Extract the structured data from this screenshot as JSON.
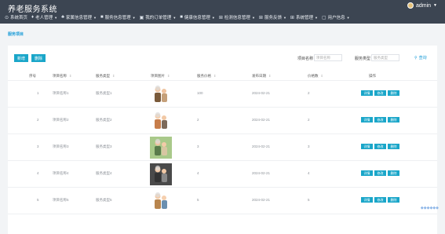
{
  "app": {
    "title": "养老服务系统",
    "user": "admin"
  },
  "nav": [
    {
      "icon": "home-icon",
      "glyph": "⊙",
      "label": "系统首页",
      "caret": false
    },
    {
      "icon": "user-icon",
      "glyph": "♦",
      "label": "老人管理",
      "caret": true
    },
    {
      "icon": "family-icon",
      "glyph": "♣",
      "label": "家属信息管理",
      "caret": true
    },
    {
      "icon": "service-icon",
      "glyph": "■",
      "label": "服务信息管理",
      "caret": true
    },
    {
      "icon": "order-icon",
      "glyph": "▣",
      "label": "我的订单管理",
      "caret": true
    },
    {
      "icon": "health-icon",
      "glyph": "■",
      "label": "健康信息管理",
      "caret": true
    },
    {
      "icon": "grid-icon",
      "glyph": "⊞",
      "label": "检测信息管理",
      "caret": true
    },
    {
      "icon": "grid-icon",
      "glyph": "⊞",
      "label": "服务反馈",
      "caret": true
    },
    {
      "icon": "grid-icon",
      "glyph": "⊞",
      "label": "系统管理",
      "caret": true
    },
    {
      "icon": "window-icon",
      "glyph": "▢",
      "label": "用户信息",
      "caret": true
    }
  ],
  "breadcrumb": "服务项目",
  "toolbar": {
    "add": "新增",
    "delete": "删除"
  },
  "filters": [
    {
      "label": "项目名称",
      "placeholder": "项目名称"
    },
    {
      "label": "服务类型",
      "placeholder": "服务类型"
    }
  ],
  "search": "查询",
  "columns": [
    "序号",
    "项目名称",
    "服务类型",
    "项目图片",
    "服务价格",
    "发布日期",
    "价格数",
    "操作"
  ],
  "rows": [
    {
      "index": "1",
      "name": "项目名称1",
      "type": "服务类型1",
      "price": "100",
      "date": "2024-02-21",
      "count": "2"
    },
    {
      "index": "2",
      "name": "项目名称2",
      "type": "服务类型2",
      "price": "2",
      "date": "2024-02-21",
      "count": "2"
    },
    {
      "index": "3",
      "name": "项目名称3",
      "type": "服务类型3",
      "price": "3",
      "date": "2024-02-21",
      "count": "3"
    },
    {
      "index": "4",
      "name": "项目名称4",
      "type": "服务类型4",
      "price": "4",
      "date": "2024-02-21",
      "count": "4"
    },
    {
      "index": "5",
      "name": "项目名称5",
      "type": "服务类型5",
      "price": "5",
      "date": "2024-02-21",
      "count": "5"
    }
  ],
  "actions": {
    "detail": "详情",
    "edit": "修改",
    "delete": "删除"
  }
}
